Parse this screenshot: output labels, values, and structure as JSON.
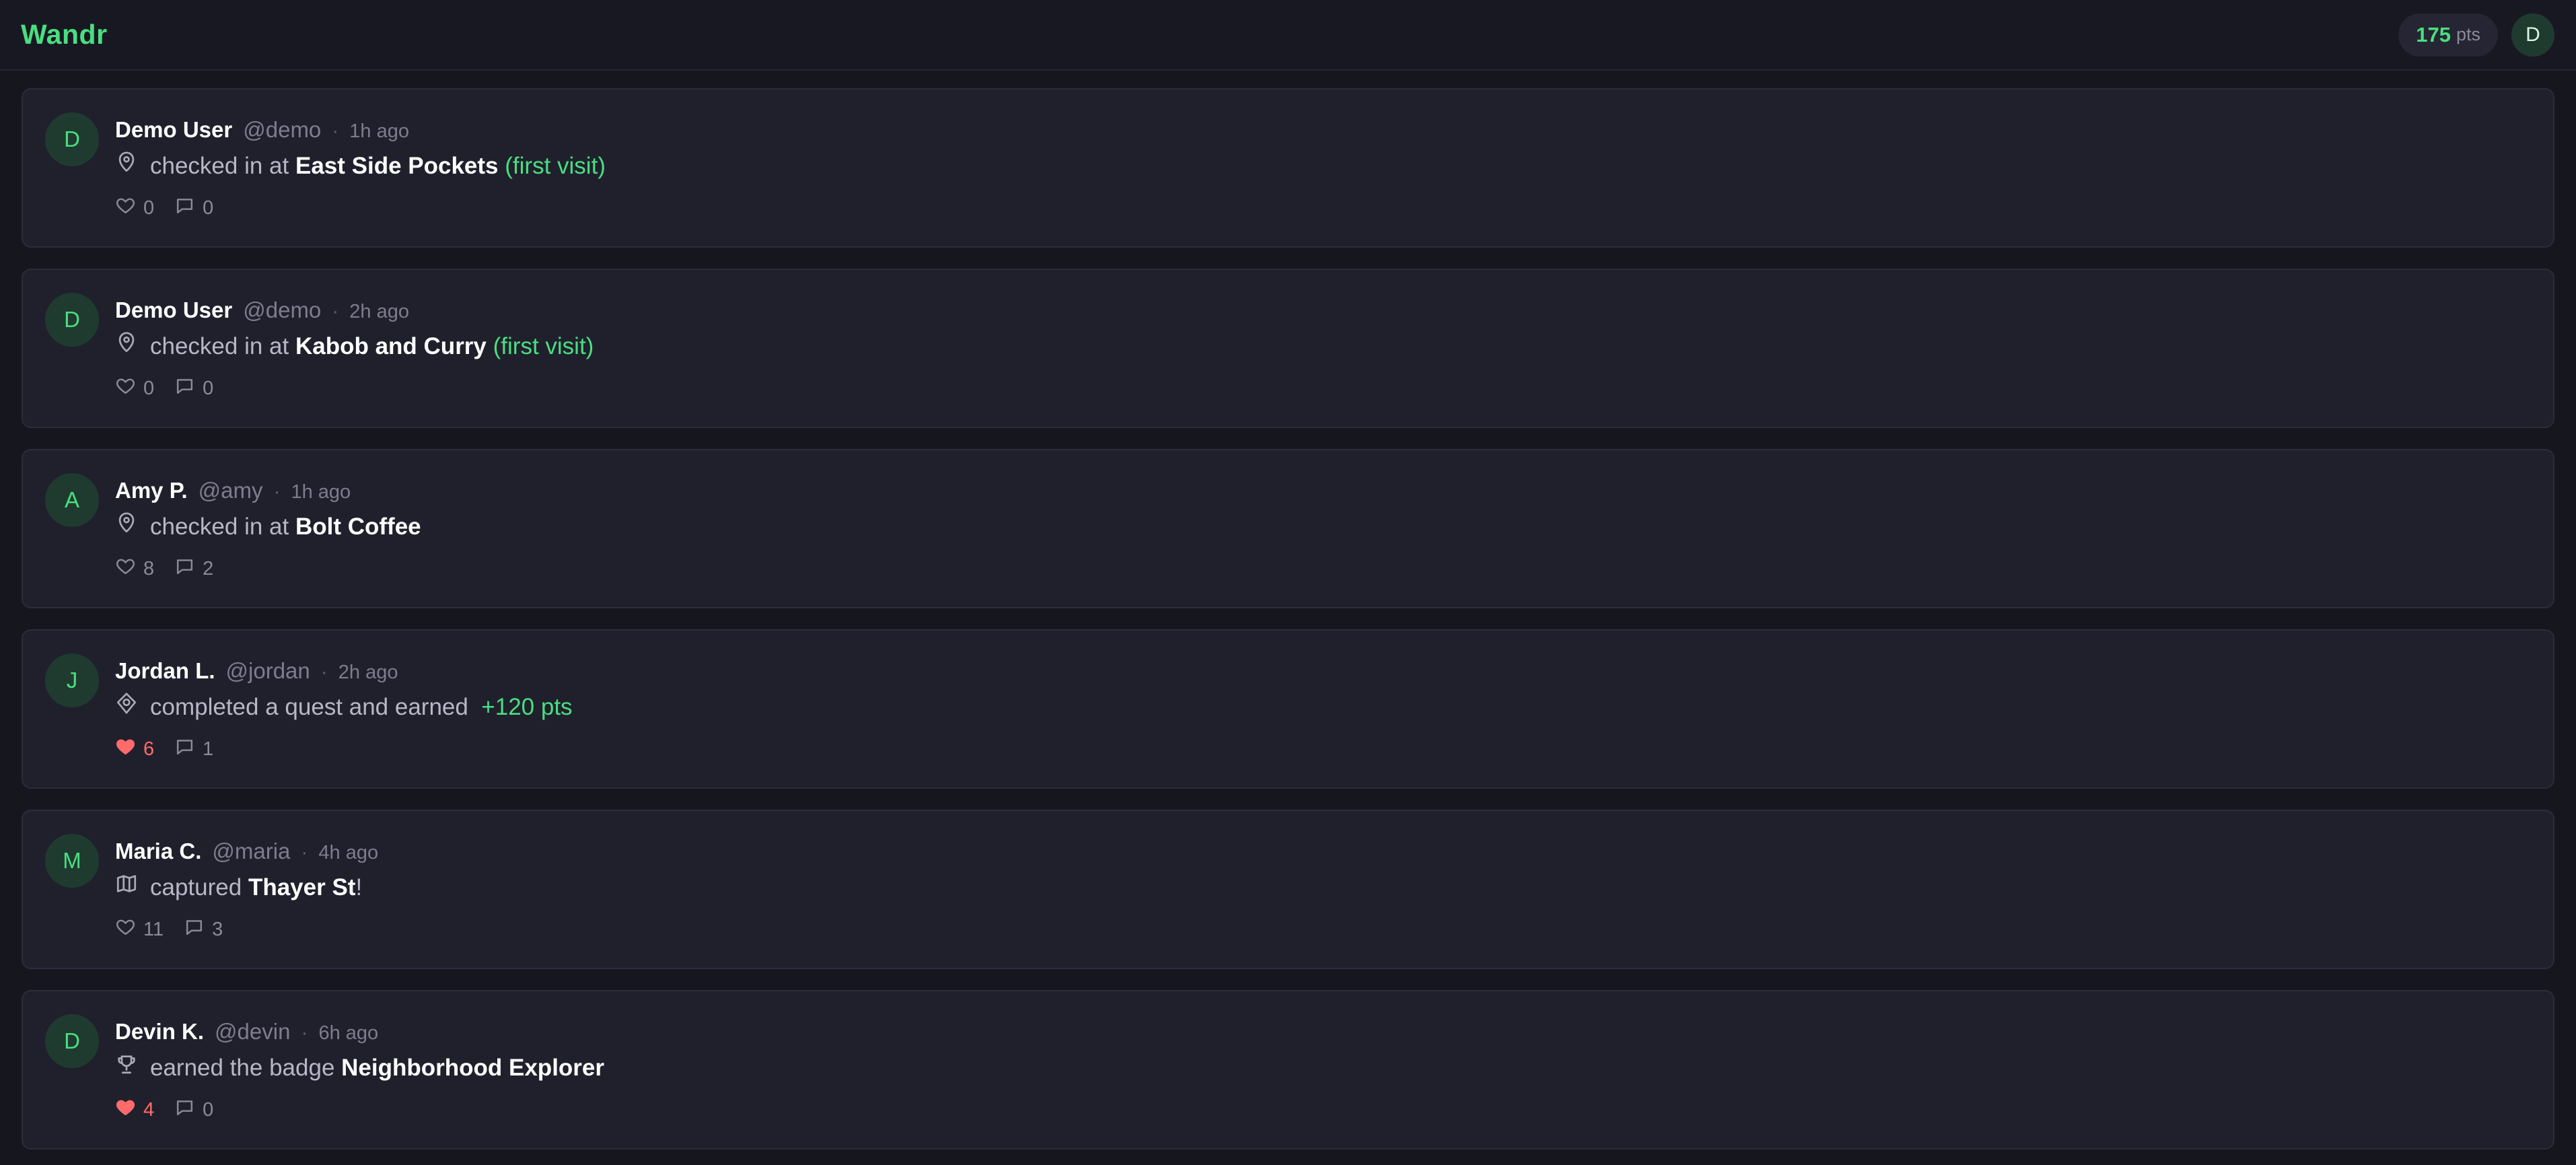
{
  "app": {
    "name": "Wandr",
    "points_value": "175",
    "points_unit": "pts",
    "user_initial": "D"
  },
  "colors": {
    "accent": "#4ade80",
    "background": "#16161f",
    "card": "#20202d",
    "like_active": "#ff6b6b"
  },
  "feed": [
    {
      "initial": "D",
      "name": "Demo User",
      "handle": "@demo",
      "time": "1h ago",
      "icon": "map-pin-icon",
      "text_before": "checked in at",
      "highlight": "East Side Pockets",
      "suffix": "(first visit)",
      "likes": "0",
      "comments": "0",
      "liked": false
    },
    {
      "initial": "D",
      "name": "Demo User",
      "handle": "@demo",
      "time": "2h ago",
      "icon": "map-pin-icon",
      "text_before": "checked in at",
      "highlight": "Kabob and Curry",
      "suffix": "(first visit)",
      "likes": "0",
      "comments": "0",
      "liked": false
    },
    {
      "initial": "A",
      "name": "Amy P.",
      "handle": "@amy",
      "time": "1h ago",
      "icon": "map-pin-icon",
      "text_before": "checked in at",
      "highlight": "Bolt Coffee",
      "suffix": "",
      "likes": "8",
      "comments": "2",
      "liked": false
    },
    {
      "initial": "J",
      "name": "Jordan L.",
      "handle": "@jordan",
      "time": "2h ago",
      "icon": "target-icon",
      "text_before": "completed a quest and earned",
      "highlight": "",
      "suffix": "+120 pts",
      "likes": "6",
      "comments": "1",
      "liked": true
    },
    {
      "initial": "M",
      "name": "Maria C.",
      "handle": "@maria",
      "time": "4h ago",
      "icon": "map-icon",
      "text_before": "captured",
      "highlight": "Thayer St",
      "after": "!",
      "suffix": "",
      "likes": "11",
      "comments": "3",
      "liked": false
    },
    {
      "initial": "D",
      "name": "Devin K.",
      "handle": "@devin",
      "time": "6h ago",
      "icon": "trophy-icon",
      "text_before": "earned the badge",
      "highlight": "Neighborhood Explorer",
      "suffix": "",
      "likes": "4",
      "comments": "0",
      "liked": true
    }
  ]
}
